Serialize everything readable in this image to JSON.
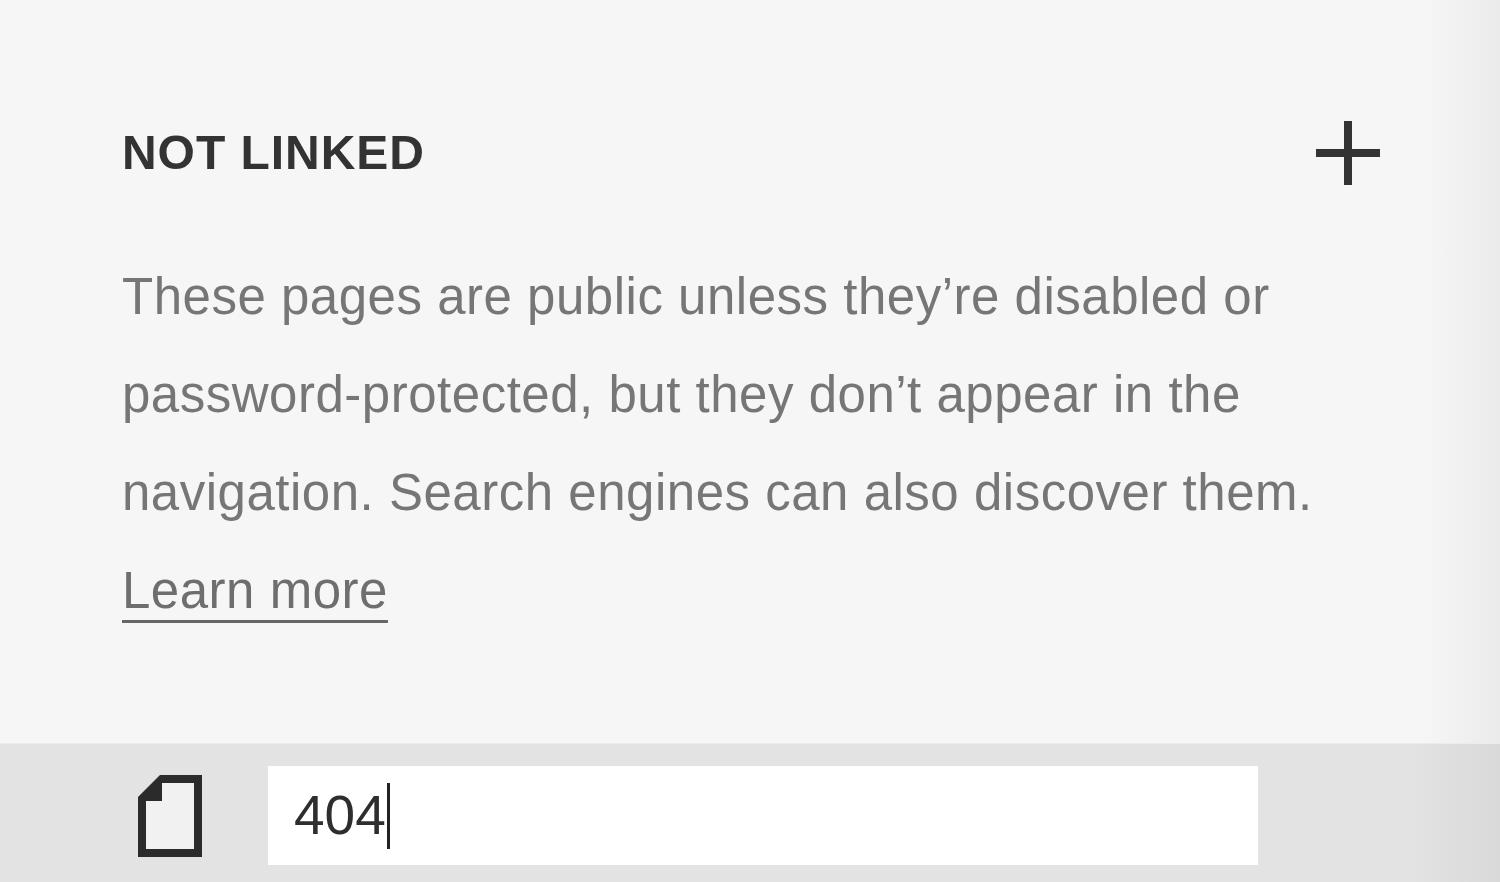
{
  "section": {
    "title": "NOT LINKED",
    "description": "These pages are public unless they’re disabled or password-protected, but they don’t appear in the navigation. Search engines can also discover them.",
    "link": "Learn more"
  },
  "pages": [
    {
      "value": "404",
      "selected": true,
      "editing": true
    }
  ]
}
